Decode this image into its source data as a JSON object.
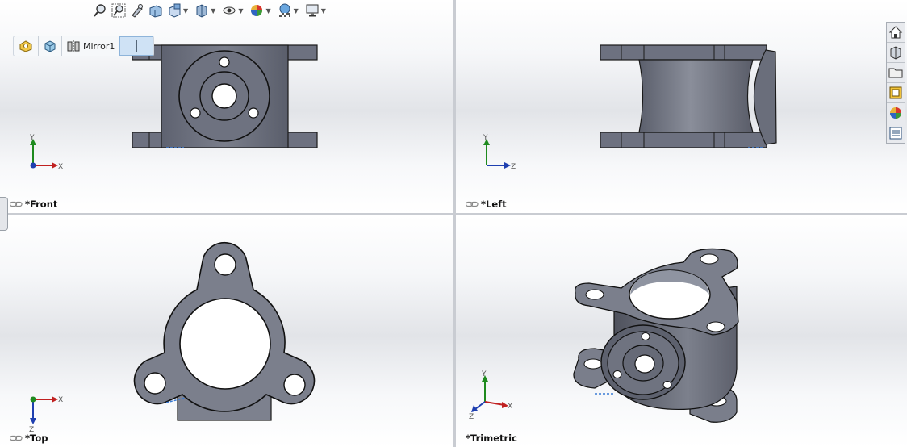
{
  "toolbar": {
    "icons": [
      "zoom-to-fit-icon",
      "zoom-to-area-icon",
      "previous-view-icon",
      "section-view-icon",
      "view-orientation-icon",
      "display-style-icon",
      "hide-show-items-icon",
      "edit-appearance-icon",
      "apply-scene-icon",
      "view-settings-icon"
    ]
  },
  "breadcrumb": {
    "items": [
      {
        "icon": "part-icon",
        "label": ""
      },
      {
        "icon": "body-icon",
        "label": ""
      },
      {
        "icon": "feature-icon",
        "label": "Mirror1"
      }
    ]
  },
  "right_panel": {
    "tabs": [
      "solidworks-resources-icon",
      "design-library-icon",
      "file-explorer-icon",
      "view-palette-icon",
      "appearances-icon",
      "custom-properties-icon"
    ]
  },
  "viewports": [
    {
      "id": "front",
      "label": "*Front",
      "axis_h": "X",
      "axis_v": "Y"
    },
    {
      "id": "left",
      "label": "*Left",
      "axis_h": "Z",
      "axis_v": "Y"
    },
    {
      "id": "top",
      "label": "*Top",
      "axis_h": "X",
      "axis_v": "Z"
    },
    {
      "id": "trimetric",
      "label": "*Trimetric",
      "axis_h": "X",
      "axis_v": "Y",
      "axis_d": "Z"
    }
  ],
  "colors": {
    "part_face": "#6b6f7c",
    "part_dark": "#4a4d58",
    "part_light": "#8f94a1",
    "axis_x": "#c02020",
    "axis_y": "#1e8a1e",
    "axis_z": "#1f3fb0",
    "divider": "#9da2aa"
  }
}
